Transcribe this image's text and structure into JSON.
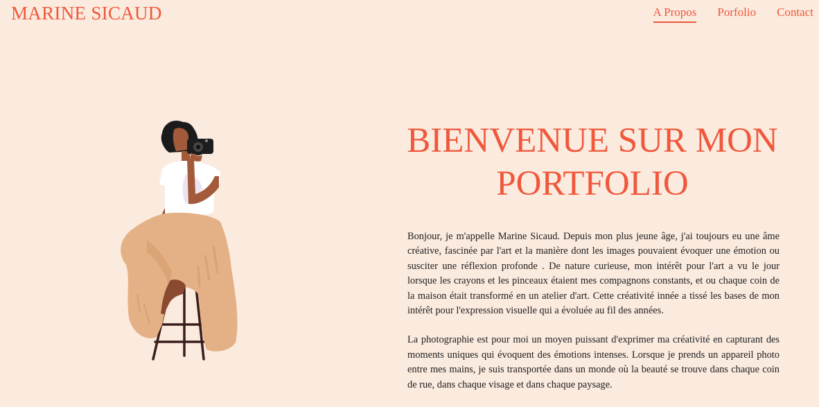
{
  "header": {
    "brand": "MARINE SICAUD",
    "nav": [
      {
        "label": "A Propos",
        "active": true
      },
      {
        "label": "Porfolio",
        "active": false
      },
      {
        "label": "Contact",
        "active": false
      }
    ]
  },
  "hero": {
    "title": "BIENVENUE SUR MON PORTFOLIO",
    "paragraphs": [
      "Bonjour, je m'appelle Marine Sicaud. Depuis mon plus jeune âge, j'ai toujours eu une âme créative, fascinée par l'art et la manière dont les images pouvaient évoquer une émotion ou susciter une réflexion profonde . De nature curieuse, mon intérêt pour l'art a vu le jour lorsque les crayons et les pinceaux étaient mes compagnons constants, et ou chaque coin de la maison était transformé en un atelier d'art. Cette créativité innée a tissé les bases de mon intérêt pour l'expression visuelle qui a évoluée au fil des années.",
      "La photographie est pour moi un moyen puissant d'exprimer ma créativité en capturant des moments uniques qui évoquent des émotions intenses. Lorsque je prends un appareil photo entre mes mains, je suis transportée dans un monde où la beauté se trouve dans chaque coin de rue, dans chaque visage et dans chaque paysage."
    ]
  },
  "theme": {
    "background": "#fbeade",
    "accent": "#f0573b",
    "text": "#1e1e1e"
  },
  "illustration": {
    "subject": "woman-photographer-on-stool",
    "colors": {
      "skin": "#a35a3b",
      "pants": "#e3b185",
      "shirt": "#ffffff",
      "hair": "#1b1b1b",
      "stool": "#3a1d1c"
    }
  }
}
